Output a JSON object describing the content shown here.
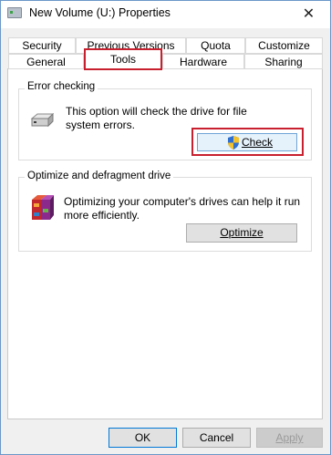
{
  "window": {
    "title": "New Volume (U:) Properties",
    "close_glyph": "✕",
    "icon": "drive-icon"
  },
  "tabs_row1": [
    {
      "label": "Security"
    },
    {
      "label": "Previous Versions"
    },
    {
      "label": "Quota"
    },
    {
      "label": "Customize"
    }
  ],
  "tabs_row2": [
    {
      "label": "General"
    },
    {
      "label": "Tools",
      "selected": true
    },
    {
      "label": "Hardware"
    },
    {
      "label": "Sharing"
    }
  ],
  "error_checking": {
    "title": "Error checking",
    "desc_line1": "This option will check the drive for file",
    "desc_line2": "system errors.",
    "button_label": "Check",
    "icon": "drive-icon",
    "button_icon": "shield-icon"
  },
  "optimize": {
    "title": "Optimize and defragment drive",
    "desc_line1": "Optimizing your computer's drives can help it run",
    "desc_line2": "more efficiently.",
    "button_label": "Optimize",
    "icon": "defrag-icon"
  },
  "footer": {
    "ok_label": "OK",
    "cancel_label": "Cancel",
    "apply_label": "Apply"
  },
  "colors": {
    "highlight": "#c8202f",
    "window_border": "#6b97c7"
  }
}
